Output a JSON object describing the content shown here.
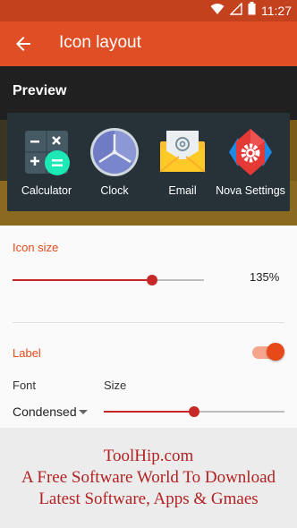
{
  "status_bar": {
    "time": "11:27"
  },
  "app_bar": {
    "title": "Icon layout"
  },
  "preview": {
    "label": "Preview",
    "apps": [
      {
        "label": "Calculator",
        "icon": "calculator-icon"
      },
      {
        "label": "Clock",
        "icon": "clock-icon"
      },
      {
        "label": "Email",
        "icon": "email-icon"
      },
      {
        "label": "Nova Settings",
        "icon": "nova-settings-icon"
      }
    ]
  },
  "icon_size": {
    "title": "Icon size",
    "value": 0.73,
    "value_text": "135%"
  },
  "label_section": {
    "title": "Label",
    "enabled": true,
    "font_label": "Font",
    "size_label": "Size",
    "font_value": "Condensed",
    "size_value": 0.5
  },
  "watermark": {
    "line1": "ToolHip.com",
    "line2": "A Free Software World To Download",
    "line3": "Latest Software, Apps & Gmaes"
  },
  "colors": {
    "primary": "#e04e26",
    "primary_dark": "#c4411e",
    "accent": "#e64a19",
    "slider": "#c62828"
  }
}
